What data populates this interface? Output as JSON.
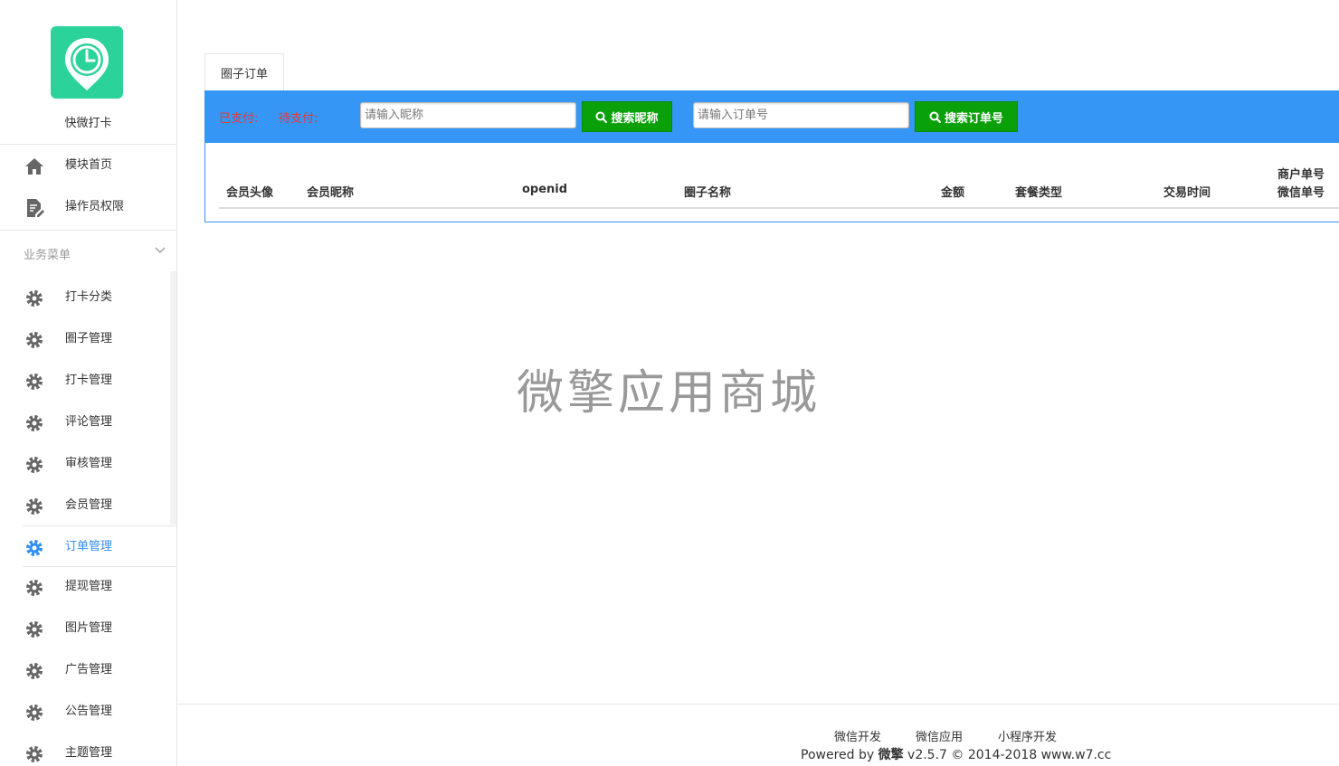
{
  "app": {
    "name": "快微打卡",
    "brand_color": "#2bd39a",
    "accent_color": "#2f8ff7"
  },
  "sidebar": {
    "top_items": [
      {
        "label": "模块首页",
        "icon": "home-icon"
      },
      {
        "label": "操作员权限",
        "icon": "document-edit-icon"
      }
    ],
    "section_title": "业务菜单",
    "items": [
      {
        "label": "打卡分类",
        "icon": "gear-icon"
      },
      {
        "label": "圈子管理",
        "icon": "gear-icon"
      },
      {
        "label": "打卡管理",
        "icon": "gear-icon"
      },
      {
        "label": "评论管理",
        "icon": "gear-icon"
      },
      {
        "label": "审核管理",
        "icon": "gear-icon"
      },
      {
        "label": "会员管理",
        "icon": "gear-icon"
      },
      {
        "label": "订单管理",
        "icon": "gear-icon",
        "active": true
      },
      {
        "label": "提现管理",
        "icon": "gear-icon"
      },
      {
        "label": "图片管理",
        "icon": "gear-icon"
      },
      {
        "label": "广告管理",
        "icon": "gear-icon"
      },
      {
        "label": "公告管理",
        "icon": "gear-icon"
      },
      {
        "label": "主题管理",
        "icon": "gear-icon"
      }
    ]
  },
  "main": {
    "tab_label": "圈子订单",
    "filters": {
      "paid_label": "已支付:",
      "pending_label": "待支付:",
      "nickname_placeholder": "请输入昵称",
      "nickname_button": "搜索昵称",
      "order_placeholder": "请输入订单号",
      "order_button": "搜索订单号"
    },
    "table": {
      "columns": [
        "会员头像",
        "会员昵称",
        "openid",
        "圈子名称",
        "金额",
        "套餐类型",
        "交易时间"
      ],
      "last_column": [
        "商户单号",
        "微信单号"
      ]
    }
  },
  "watermark": "微擎应用商城",
  "footer": {
    "links": [
      "微信开发",
      "微信应用",
      "小程序开发"
    ],
    "powered_prefix": "Powered by ",
    "powered_brand": "微擎",
    "powered_suffix": " v2.5.7 © 2014-2018 www.w7.cc"
  }
}
